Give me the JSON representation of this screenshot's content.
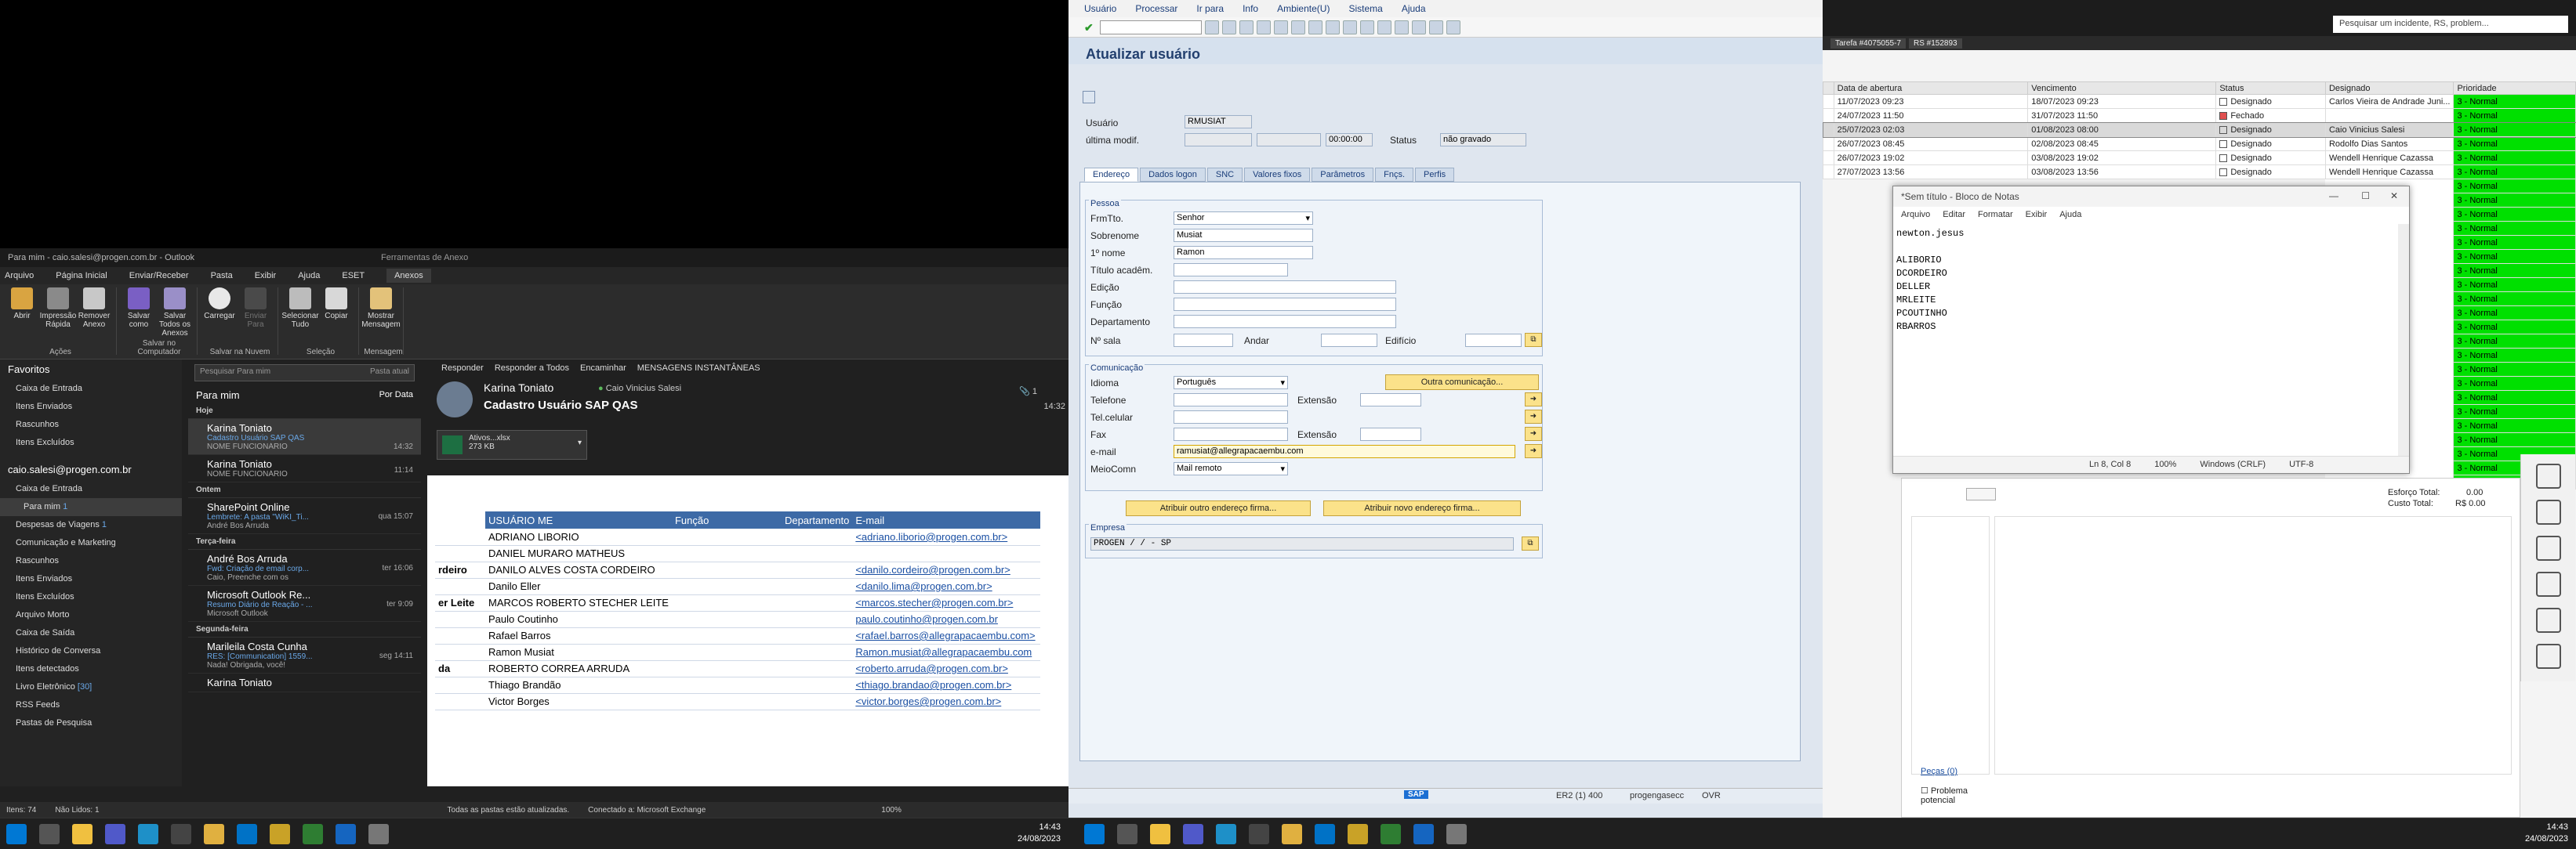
{
  "outlook": {
    "title": "Para mim - caio.salesi@progen.com.br - Outlook",
    "context_title": "Ferramentas de Anexo",
    "menu": [
      "Arquivo",
      "Página Inicial",
      "Enviar/Receber",
      "Pasta",
      "Exibir",
      "Ajuda",
      "ESET",
      "Anexos"
    ],
    "ribbon": {
      "buttons": [
        "Abrir",
        "Impressão Rápida",
        "Remover Anexo",
        "Salvar como",
        "Salvar Todos os Anexos",
        "Carregar",
        "Enviar Para",
        "Selecionar Tudo",
        "Copiar",
        "Mostrar Mensagem"
      ],
      "groups": [
        "Ações",
        "Salvar no Computador",
        "Salvar na Nuvem",
        "Seleção",
        "Mensagem"
      ]
    },
    "nav": {
      "favorites_header": "Favoritos",
      "favorites": [
        "Caixa de Entrada",
        "Itens Enviados",
        "Rascunhos",
        "Itens Excluídos"
      ],
      "account": "caio.salesi@progen.com.br",
      "folders": [
        {
          "label": "Caixa de Entrada",
          "count": ""
        },
        {
          "label": "Para mim",
          "count": "1"
        },
        {
          "label": "Despesas de Viagens",
          "count": "1"
        },
        {
          "label": "Comunicação e Marketing",
          "count": ""
        },
        {
          "label": "Rascunhos",
          "count": ""
        },
        {
          "label": "Itens Enviados",
          "count": ""
        },
        {
          "label": "Itens Excluídos",
          "count": ""
        },
        {
          "label": "Arquivo Morto",
          "count": ""
        },
        {
          "label": "Caixa de Saída",
          "count": ""
        },
        {
          "label": "Histórico de Conversa",
          "count": ""
        },
        {
          "label": "Itens detectados",
          "count": ""
        },
        {
          "label": "Livro Eletrônico",
          "count": "[30]"
        },
        {
          "label": "RSS Feeds",
          "count": ""
        },
        {
          "label": "Pastas de Pesquisa",
          "count": ""
        }
      ]
    },
    "list": {
      "search_placeholder": "Pesquisar Para mim",
      "search_scope": "Pasta atual",
      "header": "Para mim",
      "sort": "Por Data",
      "groups": [
        {
          "label": "Hoje",
          "messages": [
            {
              "from": "Karina Toniato",
              "subject": "Cadastro Usuário SAP QAS",
              "preview": "NOME FUNCIONÁRIO",
              "time": "14:32"
            },
            {
              "from": "Karina Toniato",
              "subject": "",
              "preview": "NOME FUNCIONÁRIO",
              "time": "11:14"
            }
          ]
        },
        {
          "label": "Ontem",
          "messages": [
            {
              "from": "SharePoint Online",
              "subject": "Lembrete: A pasta \"WiKI_Ti...",
              "preview": "André Bos Arruda",
              "time": "qua 15:07"
            }
          ]
        },
        {
          "label": "Terça-feira",
          "messages": [
            {
              "from": "André Bos Arruda",
              "subject": "Fwd: Criação de email corp...",
              "preview": "Caio,  Preenche com os",
              "time": "ter 16:06"
            },
            {
              "from": "Microsoft Outlook Re...",
              "subject": "Resumo Diário de Reação - ...",
              "preview": "Microsoft Outlook",
              "time": "ter 9:09"
            }
          ]
        },
        {
          "label": "Segunda-feira",
          "messages": [
            {
              "from": "Marileila Costa Cunha",
              "subject": "RES: [Communication] 1559...",
              "preview": "Nada! Obrigada, você!",
              "time": "seg 14:11"
            },
            {
              "from": "Karina Toniato",
              "subject": "",
              "preview": "",
              "time": ""
            }
          ]
        }
      ]
    },
    "reading": {
      "tools": [
        "Responder",
        "Responder a Todos",
        "Encaminhar",
        "MENSAGENS INSTANTÂNEAS"
      ],
      "from": "Karina Toniato",
      "to": "Caio Vinicius Salesi",
      "subject": "Cadastro Usuário SAP QAS",
      "attachment_name": "Ativos...xlsx",
      "attachment_size": "273 KB",
      "attachment_count": "1",
      "time": "14:32",
      "table_headers": [
        "USUÁRIO ME",
        "Função",
        "Departamento",
        "E-mail"
      ],
      "rows": [
        {
          "pre": "",
          "name": "ADRIANO LIBORIO",
          "email": "<adriano.liborio@progen.com.br>"
        },
        {
          "pre": "",
          "name": "DANIEL MURARO MATHEUS",
          "email": ""
        },
        {
          "pre": "rdeiro",
          "name": "DANILO ALVES COSTA CORDEIRO",
          "email": "<danilo.cordeiro@progen.com.br>"
        },
        {
          "pre": "",
          "name": "Danilo Eller",
          "email": "<danilo.lima@progen.com.br>"
        },
        {
          "pre": "er Leite",
          "name": "MARCOS ROBERTO STECHER LEITE",
          "email": "<marcos.stecher@progen.com.br>"
        },
        {
          "pre": "",
          "name": "Paulo Coutinho",
          "email": "paulo.coutinho@progen.com.br"
        },
        {
          "pre": "",
          "name": "Rafael Barros",
          "email": "<rafael.barros@allegrapacaembu.com>"
        },
        {
          "pre": "",
          "name": "Ramon Musiat",
          "email": "Ramon.musiat@allegrapacaembu.com"
        },
        {
          "pre": "da",
          "name": "ROBERTO CORREA ARRUDA",
          "email": "<roberto.arruda@progen.com.br>"
        },
        {
          "pre": "",
          "name": "Thiago Brandão",
          "email": "<thiago.brandao@progen.com.br>"
        },
        {
          "pre": "",
          "name": "Victor Borges",
          "email": "<victor.borges@progen.com.br>"
        }
      ]
    },
    "status": {
      "items": "Itens: 74",
      "unread": "Não Lidos: 1",
      "sync": "Todas as pastas estão atualizadas.",
      "conn": "Conectado a: Microsoft Exchange",
      "zoom": "100%"
    }
  },
  "taskbar_left": {
    "time": "14:43",
    "date": "24/08/2023"
  },
  "sap": {
    "menu": [
      "Usuário",
      "Processar",
      "Ir para",
      "Info",
      "Ambiente(U)",
      "Sistema",
      "Ajuda"
    ],
    "title": "Atualizar usuário",
    "labels": {
      "usuario": "Usuário",
      "ultima": "última modif.",
      "status": "Status"
    },
    "usuario": "RMUSIAT",
    "time_field": "00:00:00",
    "status_value": "não gravado",
    "tabs": [
      "Endereço",
      "Dados logon",
      "SNC",
      "Valores fixos",
      "Parâmetros",
      "Fnçs.",
      "Perfis"
    ],
    "pessoa": {
      "group": "Pessoa",
      "forma_lbl": "FrmTto.",
      "forma": "Senhor",
      "sobrenome_lbl": "Sobrenome",
      "sobrenome": "Musiat",
      "nome_lbl": "1º nome",
      "nome": "Ramon",
      "titulo_lbl": "Título acadêm.",
      "edicao_lbl": "Edição",
      "funcao_lbl": "Função",
      "depto_lbl": "Departamento",
      "sala_lbl": "Nº sala",
      "andar_lbl": "Andar",
      "edificio_lbl": "Edifício"
    },
    "comunicacao": {
      "group": "Comunicação",
      "idioma_lbl": "Idioma",
      "idioma": "Português",
      "outra_btn": "Outra comunicação...",
      "tel_lbl": "Telefone",
      "ext_lbl": "Extensão",
      "cel_lbl": "Tel.celular",
      "fax_lbl": "Fax",
      "email_lbl": "e-mail",
      "email": "ramusiat@allegrapacaembu.com",
      "meio_lbl": "MeioComn",
      "meio": "Mail remoto"
    },
    "buttons": [
      "Atribuir outro endereço firma...",
      "Atribuir novo endereço firma..."
    ],
    "empresa": {
      "group": "Empresa",
      "value": "PROGEN / / - SP"
    },
    "statusbar": {
      "system": "ER2 (1) 400",
      "user": "progengasecc",
      "mode": "OVR",
      "logo": "SAP"
    }
  },
  "tickets": {
    "search": "Pesquisar um incidente, RS, problem...",
    "tabs": [
      "Tarefa #4075055-7",
      "RS #152893"
    ],
    "columns": [
      "Data de abertura",
      "Vencimento",
      "Status",
      "Designado",
      "Prioridade"
    ],
    "rows": [
      {
        "open": "11/07/2023 09:23",
        "due": "18/07/2023 09:23",
        "status": "Designado",
        "assignee": "Carlos Vieira de Andrade Juni...",
        "prio": "3 - Normal"
      },
      {
        "open": "24/07/2023 11:50",
        "due": "31/07/2023 11:50",
        "status": "Fechado",
        "assignee": "",
        "prio": "3 - Normal"
      },
      {
        "open": "25/07/2023 02:03",
        "due": "01/08/2023 08:00",
        "status": "Designado",
        "assignee": "Caio Vinicius Salesi",
        "prio": "3 - Normal"
      },
      {
        "open": "26/07/2023 08:45",
        "due": "02/08/2023 08:45",
        "status": "Designado",
        "assignee": "Rodolfo Dias Santos",
        "prio": "3 - Normal"
      },
      {
        "open": "26/07/2023 19:02",
        "due": "03/08/2023 19:02",
        "status": "Designado",
        "assignee": "Wendell Henrique Cazassa",
        "prio": "3 - Normal"
      },
      {
        "open": "27/07/2023 13:56",
        "due": "03/08/2023 13:56",
        "status": "Designado",
        "assignee": "Wendell Henrique Cazassa",
        "prio": "3 - Normal"
      }
    ],
    "extra_prio": "3 - Normal",
    "lower": {
      "esforco": "Esforço Total:",
      "esforco_val": "0.00",
      "custo": "Custo Total:",
      "custo_val": "R$ 0.00",
      "pecas": "Peças (0)",
      "problema": "Problema potencial"
    }
  },
  "notepad": {
    "title": "*Sem título - Bloco de Notas",
    "menu": [
      "Arquivo",
      "Editar",
      "Formatar",
      "Exibir",
      "Ajuda"
    ],
    "text": "newton.jesus\n\nALIBORIO\nDCORDEIRO\nDELLER\nMRLEITE\nPCOUTINHO\nRBARROS",
    "status": {
      "pos": "Ln 8, Col 8",
      "zoom": "100%",
      "eol": "Windows (CRLF)",
      "enc": "UTF-8"
    }
  },
  "taskbar_right": {
    "time": "14:43",
    "date": "24/08/2023"
  }
}
